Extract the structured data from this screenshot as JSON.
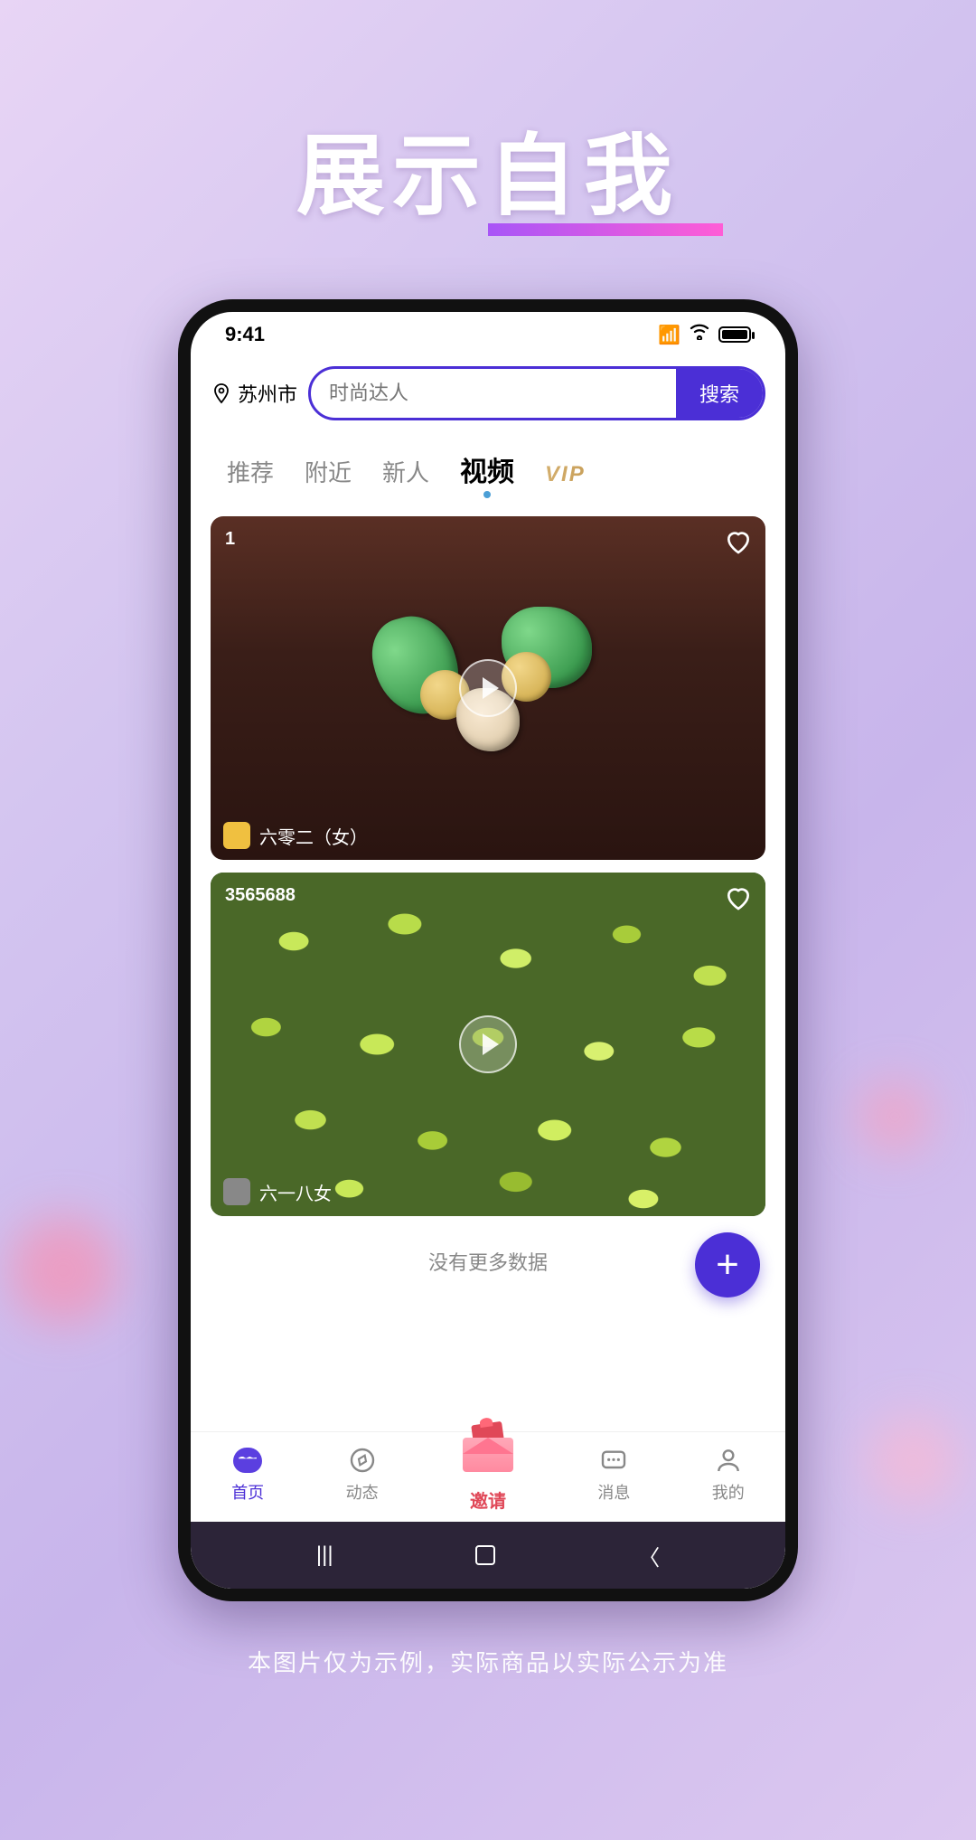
{
  "hero": {
    "title": "展示自我"
  },
  "status": {
    "time": "9:41"
  },
  "header": {
    "location": "苏州市",
    "search_placeholder": "时尚达人",
    "search_button": "搜索"
  },
  "tabs": {
    "items": [
      "推荐",
      "附近",
      "新人",
      "视频"
    ],
    "vip": "VIP",
    "active_index": 3
  },
  "videos": [
    {
      "count": "1",
      "user": "六零二（女）"
    },
    {
      "count": "3565688",
      "user": "六一八女"
    }
  ],
  "no_more": "没有更多数据",
  "bottom_nav": {
    "home": "首页",
    "feed": "动态",
    "invite": "邀请",
    "messages": "消息",
    "mine": "我的"
  },
  "disclaimer": "本图片仅为示例，实际商品以实际公示为准"
}
